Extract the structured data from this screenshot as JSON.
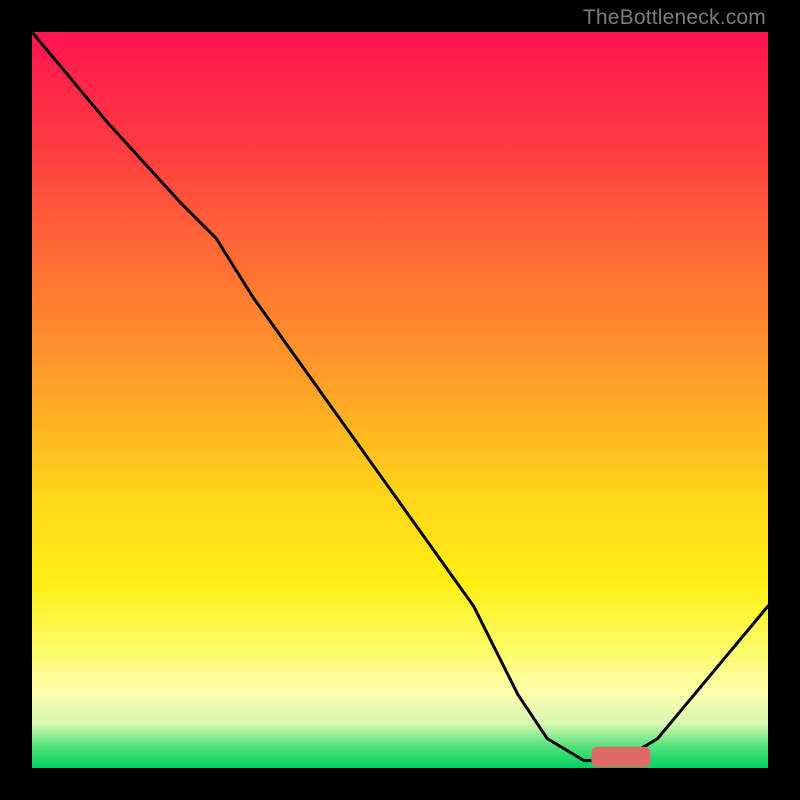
{
  "attribution": "TheBottleneck.com",
  "chart_data": {
    "type": "line",
    "title": "",
    "xlabel": "",
    "ylabel": "",
    "xlim": [
      0,
      100
    ],
    "ylim": [
      0,
      100
    ],
    "grid": false,
    "series": [
      {
        "name": "curve",
        "color": "#000000",
        "x": [
          0,
          10,
          20,
          25,
          30,
          40,
          50,
          60,
          66,
          70,
          75,
          80,
          85,
          100
        ],
        "y": [
          100,
          88,
          77,
          72,
          64,
          50,
          36,
          22,
          10,
          4,
          1,
          1,
          4,
          22
        ]
      }
    ],
    "marker": {
      "name": "optimum-bar",
      "color": "#e06a6a",
      "x_start": 76,
      "x_end": 84,
      "y": 1.5,
      "height": 2.8
    }
  }
}
